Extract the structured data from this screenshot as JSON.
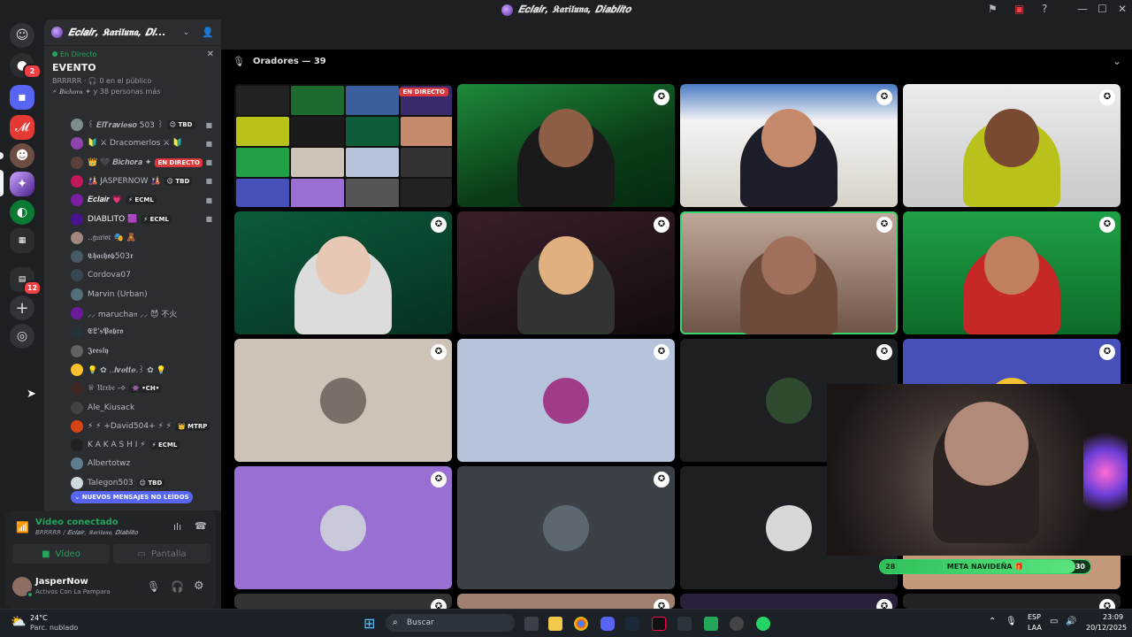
{
  "window": {
    "title": "𝑬𝒄𝒍𝒂𝒊𝒓, 𝕶𝖆𝖗𝖎𝖑𝖚𝖓𝖆, 𝑫𝒊𝒂𝒃𝒍𝒊𝒕𝒐"
  },
  "rail": {
    "badges": [
      "2",
      "12"
    ]
  },
  "sidebar": {
    "channel_name": "𝑬𝒄𝒍𝒂𝒊𝒓, 𝕶𝖆𝖗𝖎𝖑𝖚𝖓𝖆, 𝑫𝒊...",
    "live_label": "En Directo",
    "event_title": "EVENTO",
    "event_meta": "BRRRRR · 🎧 0 en el público",
    "event_count": "🗲 𝑩𝒊𝒄𝒉𝒐𝒓𝒂 ✦ y 38 personas más",
    "members": [
      {
        "name": "꒰ 𝑬𝒍𝑻𝒓𝒂𝒗𝒊𝒆𝒔𝒐 503 ꒱",
        "tag": "😉 TBD",
        "live": "",
        "cam": true
      },
      {
        "name": "🔰 ⚔ Dracomerlos ⚔ 🔰",
        "tag": "",
        "live": "",
        "cam": true
      },
      {
        "name": "👑 🖤 𝑩𝒊𝒄𝒉𝒐𝒓𝒂 ✦",
        "tag": "",
        "live": "EN DIRECTO",
        "cam": true
      },
      {
        "name": "🎎 JASPERNOW 🎎",
        "tag": "😉 TBD",
        "live": "",
        "cam": true
      },
      {
        "name": "𝑬𝒄𝒍𝒂𝒊𝒓 💗",
        "tag": "⚡ ECML",
        "live": "",
        "cam": true
      },
      {
        "name": "DIABLITO 🟪",
        "tag": "⚡ ECML",
        "live": "",
        "cam": true
      },
      {
        "name": "..𝔤𝔲𝔯𝔦𝔬𝔯 🎭 🧸",
        "tag": "",
        "live": "",
        "cam": false
      },
      {
        "name": "𝕮𝖍𝖆𝖈𝖍𝖔𝖇503𝖗",
        "tag": "",
        "live": "",
        "cam": false
      },
      {
        "name": "Cordova07",
        "tag": "",
        "live": "",
        "cam": false
      },
      {
        "name": "Marvin (Urban)",
        "tag": "",
        "live": "",
        "cam": false
      },
      {
        "name": "⸝⸝ marucha𝔫 ⸝⸝ 😈 不火",
        "tag": "",
        "live": "",
        "cam": false
      },
      {
        "name": "𝕰𝕷'𝖘𝕻𝖆𝖇𝖗𝖔",
        "tag": "",
        "live": "",
        "cam": false
      },
      {
        "name": "𝕵𝖊𝖊𝖘𝖑𝖞",
        "tag": "",
        "live": "",
        "cam": false
      },
      {
        "name": "💡 ✿ ..𝑰𝒗𝒆𝒕𝒕𝒆.꒱ ✿ 💡",
        "tag": "",
        "live": "",
        "cam": false
      },
      {
        "name": "♕ 𝔘𝔯𝔵𝔟𝔢 -⟡",
        "tag": "👾 •CH•",
        "live": "",
        "cam": false
      },
      {
        "name": "Ale_Kiusack",
        "tag": "",
        "live": "",
        "cam": false
      },
      {
        "name": "⚡ ⚡ +David504+ ⚡ ⚡",
        "tag": "👑 MTRP",
        "live": "",
        "cam": false
      },
      {
        "name": "K A K A S H I ⚡",
        "tag": "⚡ ECML",
        "live": "",
        "cam": false
      },
      {
        "name": "Albertotwz",
        "tag": "",
        "live": "",
        "cam": false
      },
      {
        "name": "Talegon503",
        "tag": "😉 TBD",
        "live": "",
        "cam": false
      }
    ],
    "unread_label": "⌄ NUEVOS MENSAJES NO LEÍDOS"
  },
  "voice": {
    "status": "Vídeo conectado",
    "server": "BRRRRR / 𝑬𝒄𝒍𝒂𝒊𝒓, 𝕶𝖆𝖗𝖎𝖑𝖚𝖓𝖆, 𝑫𝒊𝒂𝒃𝒍𝒊𝒕𝒐",
    "video_label": "Vídeo",
    "screen_label": "Pantalla"
  },
  "user": {
    "name": "JasperNow",
    "status": "Activos Con La Pampara"
  },
  "stage": {
    "speakers_label": "Oradores — 39",
    "live_badge": "EN DIRECTO"
  },
  "goal": {
    "label": "META NAVIDEÑA 🎁",
    "current": "28",
    "target": "30",
    "progress": 0.93
  },
  "taskbar": {
    "weather_temp": "24°C",
    "weather_desc": "Parc. nublado",
    "search_placeholder": "Buscar",
    "lang": "ESP",
    "lang2": "LAA",
    "time": "23:09",
    "date": "20/12/2025"
  },
  "colors": {
    "accent": "#5865f2",
    "live": "#da373c",
    "online": "#23a55a"
  }
}
